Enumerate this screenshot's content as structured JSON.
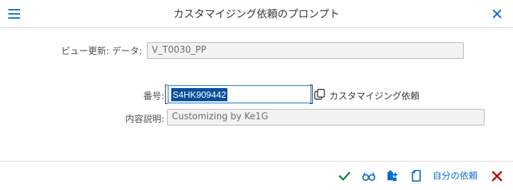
{
  "dialog": {
    "title": "カスタマイジング依頼のプロンプト"
  },
  "form": {
    "view_label": "ビュー更新: データ:",
    "view_value": "V_T0030_PP",
    "number_label": "番号:",
    "number_value": "S4HK909442",
    "number_description": "カスタマイジング依頼",
    "description_label": "内容説明:",
    "description_value": "Customizing by Ke1G"
  },
  "footer": {
    "own_requests_label": "自分の依頼"
  },
  "icons": {
    "menu": "hamburger-icon",
    "close": "close-icon",
    "value_help": "value-help-icon",
    "confirm": "checkmark-icon",
    "display": "glasses-icon",
    "create": "create-request-icon",
    "copy": "copy-icon",
    "cancel": "cancel-icon"
  },
  "colors": {
    "accent": "#0a6ed1",
    "confirm": "#107e3e",
    "cancel": "#bb0000",
    "selection": "#0a4f9c"
  }
}
